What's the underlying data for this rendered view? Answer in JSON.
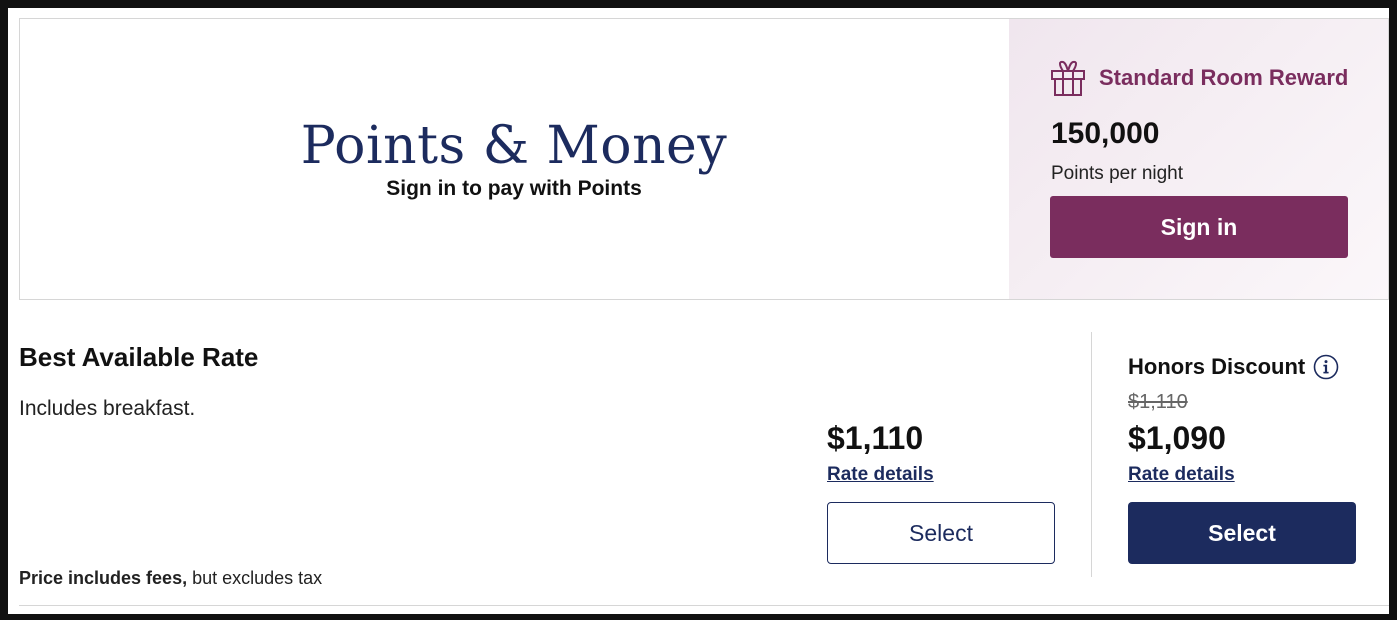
{
  "promo": {
    "title": "Points & Money",
    "subtitle": "Sign in to pay with Points"
  },
  "reward": {
    "icon": "gift-icon",
    "title": "Standard Room Reward",
    "points": "150,000",
    "unit": "Points per night",
    "signin_label": "Sign in",
    "accent_color": "#7a2d5e"
  },
  "rate": {
    "title": "Best Available Rate",
    "description": "Includes breakfast.",
    "note_bold": "Price includes fees,",
    "note_rest": " but excludes tax"
  },
  "standard": {
    "price": "$1,110",
    "details_link": "Rate details",
    "select_label": "Select"
  },
  "discount": {
    "title": "Honors Discount",
    "info_icon": "info-icon",
    "old_price": "$1,110",
    "price": "$1,090",
    "details_link": "Rate details",
    "select_label": "Select",
    "brand_color": "#1c2b5e"
  }
}
